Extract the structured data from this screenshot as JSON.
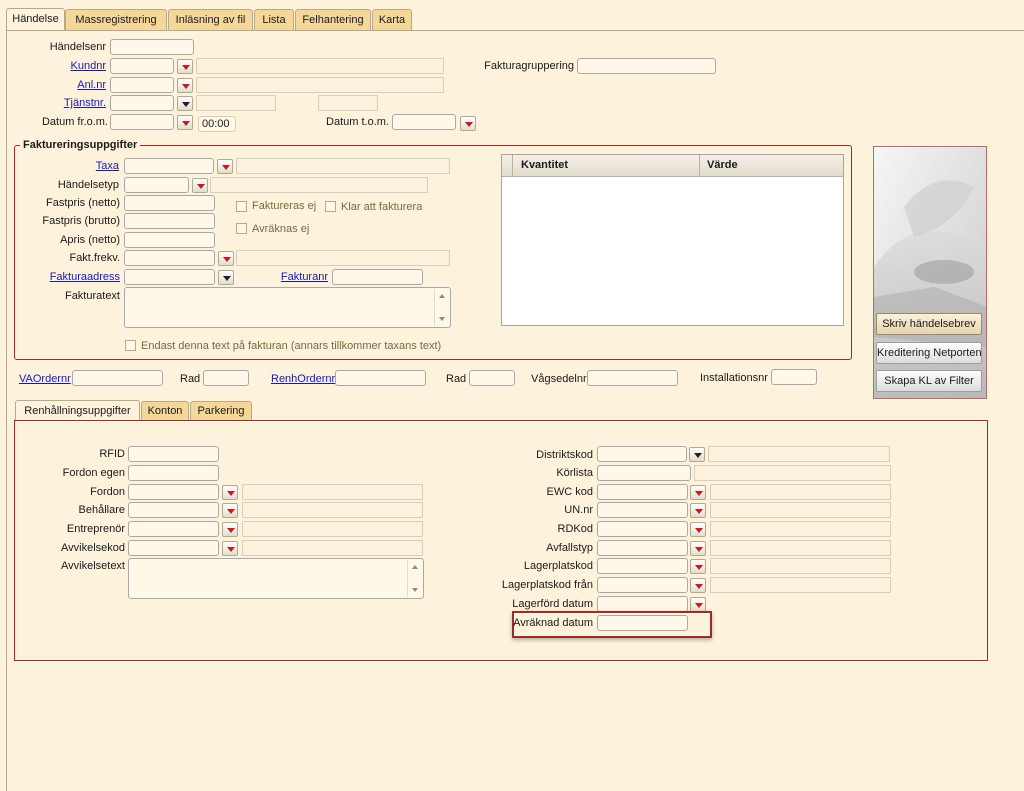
{
  "tabs": {
    "handelse": "Händelse",
    "massreg": "Massregistrering",
    "inlasning": "Inläsning av fil",
    "lista": "Lista",
    "felhantering": "Felhantering",
    "karta": "Karta"
  },
  "header": {
    "handelsenr": "Händelsenr",
    "kundnr": "Kundnr",
    "anlnr": "Anl.nr",
    "tjanstnr": "Tjänstnr.",
    "datum_from": "Datum fr.o.m.",
    "time_value": "00:00",
    "datum_tom": "Datum t.o.m.",
    "fakturagruppering": "Fakturagruppering"
  },
  "fakturering": {
    "legend": "Faktureringsuppgifter",
    "taxa": "Taxa",
    "handelsetyp": "Händelsetyp",
    "fastpris_netto": "Fastpris (netto)",
    "fastpris_brutto": "Fastpris (brutto)",
    "apris_netto": "Apris (netto)",
    "fakt_frekv": "Fakt.frekv.",
    "fakturaadress": "Fakturaadress",
    "fakturanr": "Fakturanr",
    "fakturatext": "Fakturatext",
    "faktureras_ej": "Faktureras ej",
    "klar_att_fakturera": "Klar att fakturera",
    "avraknas_ej": "Avräknas ej",
    "endast_text": "Endast denna text på fakturan (annars tillkommer taxans text)",
    "grid_col_kvantitet": "Kvantitet",
    "grid_col_varde": "Värde"
  },
  "actions": {
    "skriv": "Skriv händelsebrev",
    "kreditering": "Kreditering Netporten",
    "skapa": "Skapa KL av Filter"
  },
  "order_row": {
    "vaordernr": "VAOrdernr",
    "rad1": "Rad",
    "renhordernr": "RenhOrdernr",
    "rad2": "Rad",
    "vagsedelnr": "Vågsedelnr",
    "installationsnr": "Installationsnr"
  },
  "subtabs": {
    "renhallning": "Renhållningsuppgifter",
    "konton": "Konton",
    "parkering": "Parkering"
  },
  "renh_left": {
    "rfid": "RFID",
    "fordon_egen": "Fordon egen",
    "fordon": "Fordon",
    "behallare": "Behållare",
    "entreprenor": "Entreprenör",
    "avvikelsekod": "Avvikelsekod",
    "avvikelsetext": "Avvikelsetext"
  },
  "renh_right": {
    "distriktskod": "Distriktskod",
    "korlista": "Körlista",
    "ewc_kod": "EWC kod",
    "un_nr": "UN.nr",
    "rdkod": "RDKod",
    "avfallstyp": "Avfallstyp",
    "lagerplatskod": "Lagerplatskod",
    "lagerplatskod_fran": "Lagerplatskod från",
    "lagerford_datum": "Lagerförd datum",
    "avraknad_datum": "Avräknad datum"
  },
  "colors": {
    "background": "#fdf3dd",
    "tab_inactive": "#f6d79a",
    "panel_border": "#9c2b2b",
    "link": "#1a1aa8",
    "highlight": "#9c2b2b"
  }
}
